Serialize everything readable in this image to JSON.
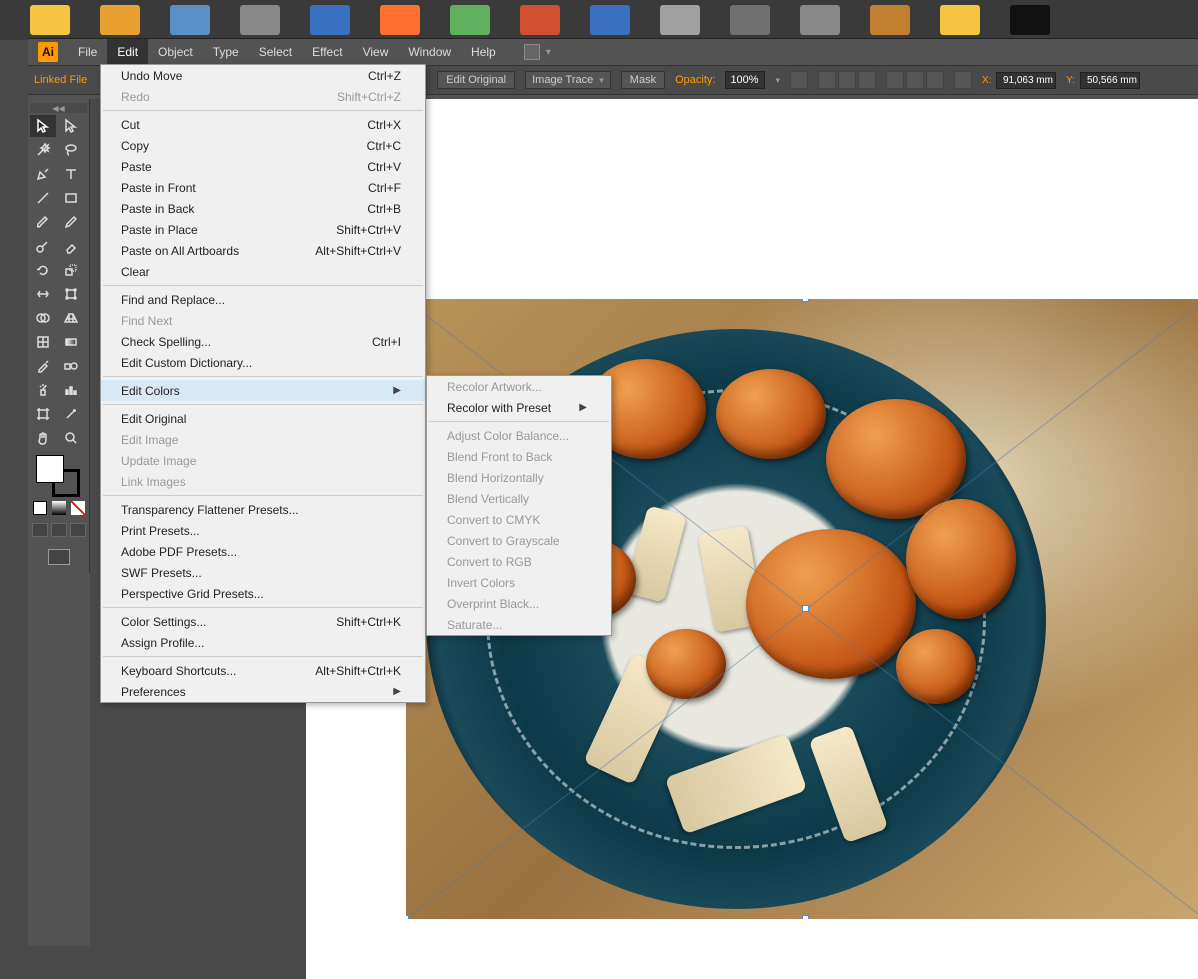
{
  "menubar": {
    "items": [
      "File",
      "Edit",
      "Object",
      "Type",
      "Select",
      "Effect",
      "View",
      "Window",
      "Help"
    ],
    "active": "Edit"
  },
  "controlbar": {
    "label": "Linked File",
    "edit_original": "Edit Original",
    "image_trace": "Image Trace",
    "mask": "Mask",
    "opacity_label": "Opacity:",
    "opacity_value": "100%",
    "x_label": "X:",
    "x_value": "91,063 mm",
    "y_label": "Y:",
    "y_value": "50,566 mm"
  },
  "edit_menu": [
    {
      "label": "Undo Move",
      "shortcut": "Ctrl+Z"
    },
    {
      "label": "Redo",
      "shortcut": "Shift+Ctrl+Z",
      "disabled": true
    },
    {
      "sep": true
    },
    {
      "label": "Cut",
      "shortcut": "Ctrl+X"
    },
    {
      "label": "Copy",
      "shortcut": "Ctrl+C"
    },
    {
      "label": "Paste",
      "shortcut": "Ctrl+V"
    },
    {
      "label": "Paste in Front",
      "shortcut": "Ctrl+F"
    },
    {
      "label": "Paste in Back",
      "shortcut": "Ctrl+B"
    },
    {
      "label": "Paste in Place",
      "shortcut": "Shift+Ctrl+V"
    },
    {
      "label": "Paste on All Artboards",
      "shortcut": "Alt+Shift+Ctrl+V"
    },
    {
      "label": "Clear"
    },
    {
      "sep": true
    },
    {
      "label": "Find and Replace..."
    },
    {
      "label": "Find Next",
      "disabled": true
    },
    {
      "label": "Check Spelling...",
      "shortcut": "Ctrl+I"
    },
    {
      "label": "Edit Custom Dictionary..."
    },
    {
      "sep": true
    },
    {
      "label": "Edit Colors",
      "submenu": true,
      "hover": true
    },
    {
      "sep": true
    },
    {
      "label": "Edit Original"
    },
    {
      "label": "Edit Image",
      "disabled": true
    },
    {
      "label": "Update Image",
      "disabled": true
    },
    {
      "label": "Link Images",
      "disabled": true
    },
    {
      "sep": true
    },
    {
      "label": "Transparency Flattener Presets..."
    },
    {
      "label": "Print Presets..."
    },
    {
      "label": "Adobe PDF Presets..."
    },
    {
      "label": "SWF Presets..."
    },
    {
      "label": "Perspective Grid Presets..."
    },
    {
      "sep": true
    },
    {
      "label": "Color Settings...",
      "shortcut": "Shift+Ctrl+K"
    },
    {
      "label": "Assign Profile..."
    },
    {
      "sep": true
    },
    {
      "label": "Keyboard Shortcuts...",
      "shortcut": "Alt+Shift+Ctrl+K"
    },
    {
      "label": "Preferences",
      "submenu": true
    }
  ],
  "sub_menu": [
    {
      "label": "Recolor Artwork...",
      "disabled": true
    },
    {
      "label": "Recolor with Preset",
      "submenu": true
    },
    {
      "sep": true
    },
    {
      "label": "Adjust Color Balance...",
      "disabled": true
    },
    {
      "label": "Blend Front to Back",
      "disabled": true
    },
    {
      "label": "Blend Horizontally",
      "disabled": true
    },
    {
      "label": "Blend Vertically",
      "disabled": true
    },
    {
      "label": "Convert to CMYK",
      "disabled": true
    },
    {
      "label": "Convert to Grayscale",
      "disabled": true
    },
    {
      "label": "Convert to RGB",
      "disabled": true
    },
    {
      "label": "Invert Colors",
      "disabled": true
    },
    {
      "label": "Overprint Black...",
      "disabled": true
    },
    {
      "label": "Saturate...",
      "disabled": true
    }
  ],
  "taskbar_colors": [
    "#f5c542",
    "#e8a030",
    "#5a90c8",
    "#888",
    "#3a70c0",
    "#ff7030",
    "#60b060",
    "#d05030",
    "#3a70c0",
    "#a0a0a0",
    "#707070",
    "#888",
    "#c08030",
    "#f5c542",
    "#000"
  ]
}
